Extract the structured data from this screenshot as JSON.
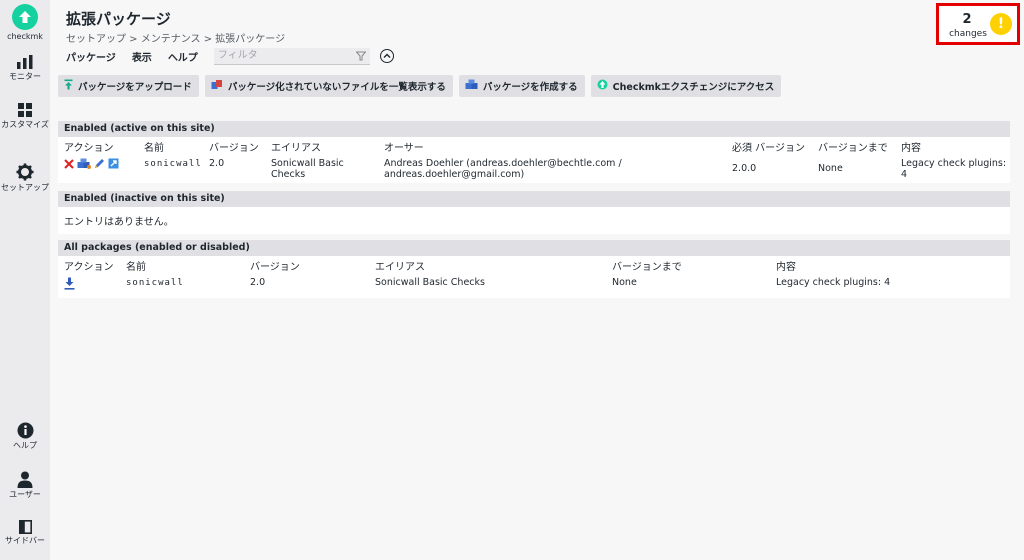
{
  "sidebar": {
    "logo_label": "checkmk",
    "items": [
      {
        "label": "モニター",
        "icon": "bar-chart-icon"
      },
      {
        "label": "カスタマイズ",
        "icon": "grid-icon"
      },
      {
        "label": "セットアップ",
        "icon": "gear-icon"
      },
      {
        "label": "ヘルプ",
        "icon": "info-icon"
      },
      {
        "label": "ユーザー",
        "icon": "user-icon"
      },
      {
        "label": "サイドバー",
        "icon": "sidebar-toggle-icon"
      }
    ]
  },
  "header": {
    "title": "拡張パッケージ",
    "breadcrumb": "セットアップ > メンテナンス > 拡張パッケージ",
    "changes_count": "2",
    "changes_label": "changes",
    "warning_symbol": "!"
  },
  "menu": {
    "items": [
      "パッケージ",
      "表示",
      "ヘルプ"
    ],
    "filter_placeholder": "フィルタ"
  },
  "actions": [
    {
      "label": "パッケージをアップロード",
      "icon": "upload-icon"
    },
    {
      "label": "パッケージ化されていないファイルを一覧表示する",
      "icon": "files-icon"
    },
    {
      "label": "パッケージを作成する",
      "icon": "package-icon"
    },
    {
      "label": "Checkmkエクスチェンジにアクセス",
      "icon": "exchange-icon"
    }
  ],
  "section_active": {
    "title": "Enabled (active on this site)",
    "columns": [
      "アクション",
      "名前",
      "バージョン",
      "エイリアス",
      "オーサー",
      "必須 バージョン",
      "バージョンまで",
      "内容"
    ],
    "rows": [
      {
        "name": "sonicwall",
        "version": "2.0",
        "alias": "Sonicwall Basic Checks",
        "author": "Andreas Doehler (andreas.doehler@bechtle.com / andreas.doehler@gmail.com)",
        "required_version": "2.0.0",
        "until_version": "None",
        "content": "Legacy check plugins: 4"
      }
    ]
  },
  "section_inactive": {
    "title": "Enabled (inactive on this site)",
    "empty_text": "エントリはありません。"
  },
  "section_all": {
    "title": "All packages (enabled or disabled)",
    "columns": [
      "アクション",
      "名前",
      "バージョン",
      "エイリアス",
      "バージョンまで",
      "内容"
    ],
    "rows": [
      {
        "name": "sonicwall",
        "version": "2.0",
        "alias": "Sonicwall Basic Checks",
        "until_version": "None",
        "content": "Legacy check plugins: 4"
      }
    ]
  },
  "colors": {
    "brand": "#15d1a0",
    "highlight": "#e30000",
    "warning": "#ffd100"
  }
}
